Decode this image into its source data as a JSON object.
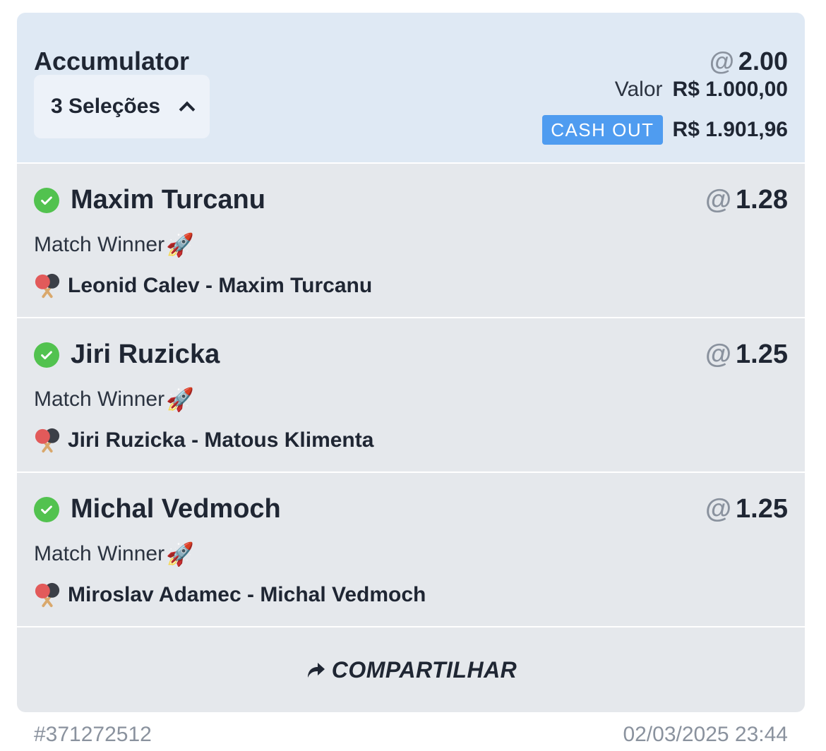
{
  "bet": {
    "title": "Accumulator",
    "at_symbol": "@",
    "total_odds": "2.00",
    "selections_label": "3 Seleções",
    "valor_label": "Valor",
    "valor_amount": "R$ 1.000,00",
    "cashout_label": "CASH OUT",
    "cashout_amount": "R$ 1.901,96"
  },
  "selections": [
    {
      "name": "Maxim Turcanu",
      "odds": "1.28",
      "market": "Match Winner",
      "market_emoji": "🚀",
      "event": "Leonid Calev - Maxim Turcanu",
      "status_icon": "check-circle-icon",
      "sport_icon": "ping-pong-icon"
    },
    {
      "name": "Jiri Ruzicka",
      "odds": "1.25",
      "market": "Match Winner",
      "market_emoji": "🚀",
      "event": "Jiri Ruzicka - Matous Klimenta",
      "status_icon": "check-circle-icon",
      "sport_icon": "ping-pong-icon"
    },
    {
      "name": "Michal Vedmoch",
      "odds": "1.25",
      "market": "Match Winner",
      "market_emoji": "🚀",
      "event": "Miroslav Adamec - Michal Vedmoch",
      "status_icon": "check-circle-icon",
      "sport_icon": "ping-pong-icon"
    }
  ],
  "share": {
    "label": "COMPARTILHAR",
    "icon": "share-arrow-icon"
  },
  "footer": {
    "bet_id": "#371272512",
    "datetime": "02/03/2025 23:44"
  },
  "colors": {
    "header_bg": "#dfe9f4",
    "selection_bg": "#e5e8ec",
    "cashout_badge": "#4f9cf0",
    "check_green": "#52c24f"
  }
}
